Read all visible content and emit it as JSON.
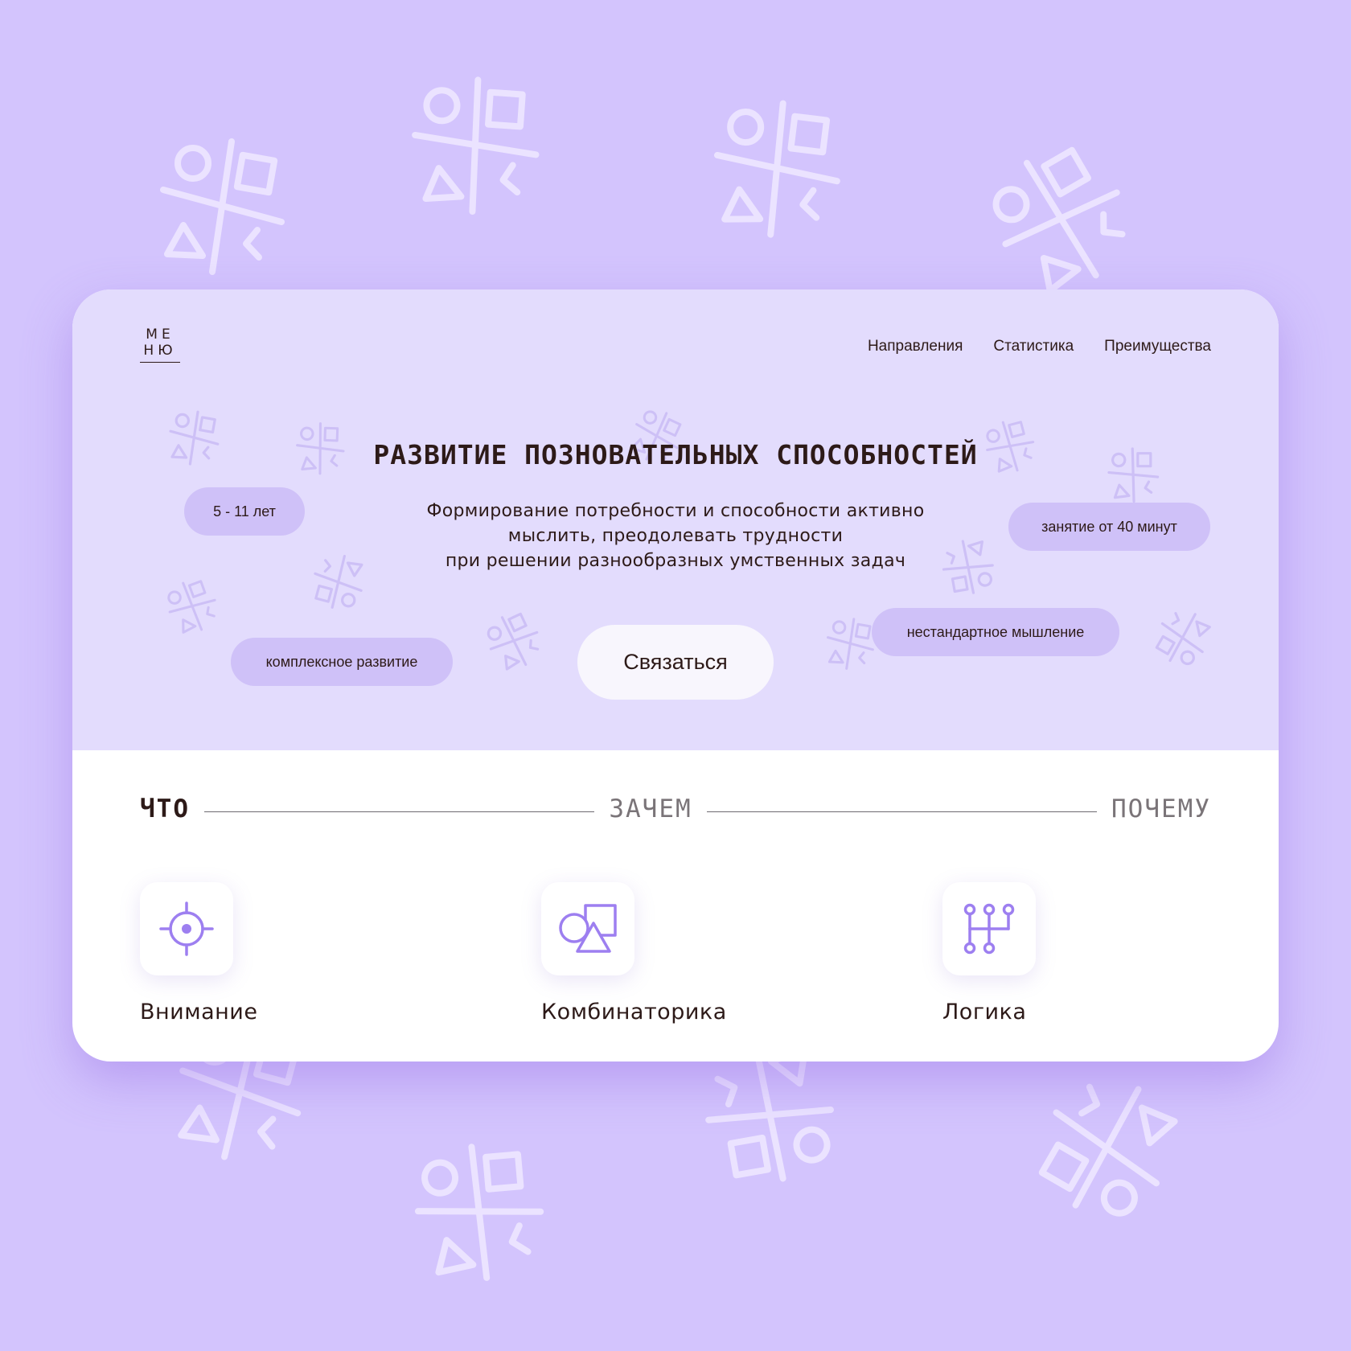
{
  "logo": {
    "line1": "МЕ",
    "line2": "НЮ"
  },
  "nav": {
    "items": [
      {
        "label": "Направления"
      },
      {
        "label": "Статистика"
      },
      {
        "label": "Преимущества"
      }
    ]
  },
  "hero": {
    "title": "РАЗВИТИЕ ПОЗНОВАТЕЛЬНЫХ СПОСОБНОСТЕЙ",
    "subtitle_lines": [
      "Формирование потребности и способности активно",
      "мыслить, преодолевать трудности",
      "при решении разнообразных умственных задач"
    ],
    "tags": {
      "age": "5 - 11 лет",
      "duration": "занятие от 40 минут",
      "complex": "комплексное развитие",
      "thinking": "нестандартное мышление"
    },
    "cta_label": "Связаться"
  },
  "tabs": {
    "what": "ЧТО",
    "why": "ЗАЧЕМ",
    "reason": "ПОЧЕМУ",
    "active": "what"
  },
  "features": [
    {
      "label": "Внимание",
      "icon": "target-icon"
    },
    {
      "label": "Комбинаторика",
      "icon": "shapes-icon"
    },
    {
      "label": "Логика",
      "icon": "logic-tree-icon"
    }
  ],
  "colors": {
    "page_background": "#d3c4fd",
    "hero_background": "#e3dcfd",
    "pill": "#cfc1f8",
    "accent": "#9d7ff0",
    "text": "#2d1a18"
  }
}
